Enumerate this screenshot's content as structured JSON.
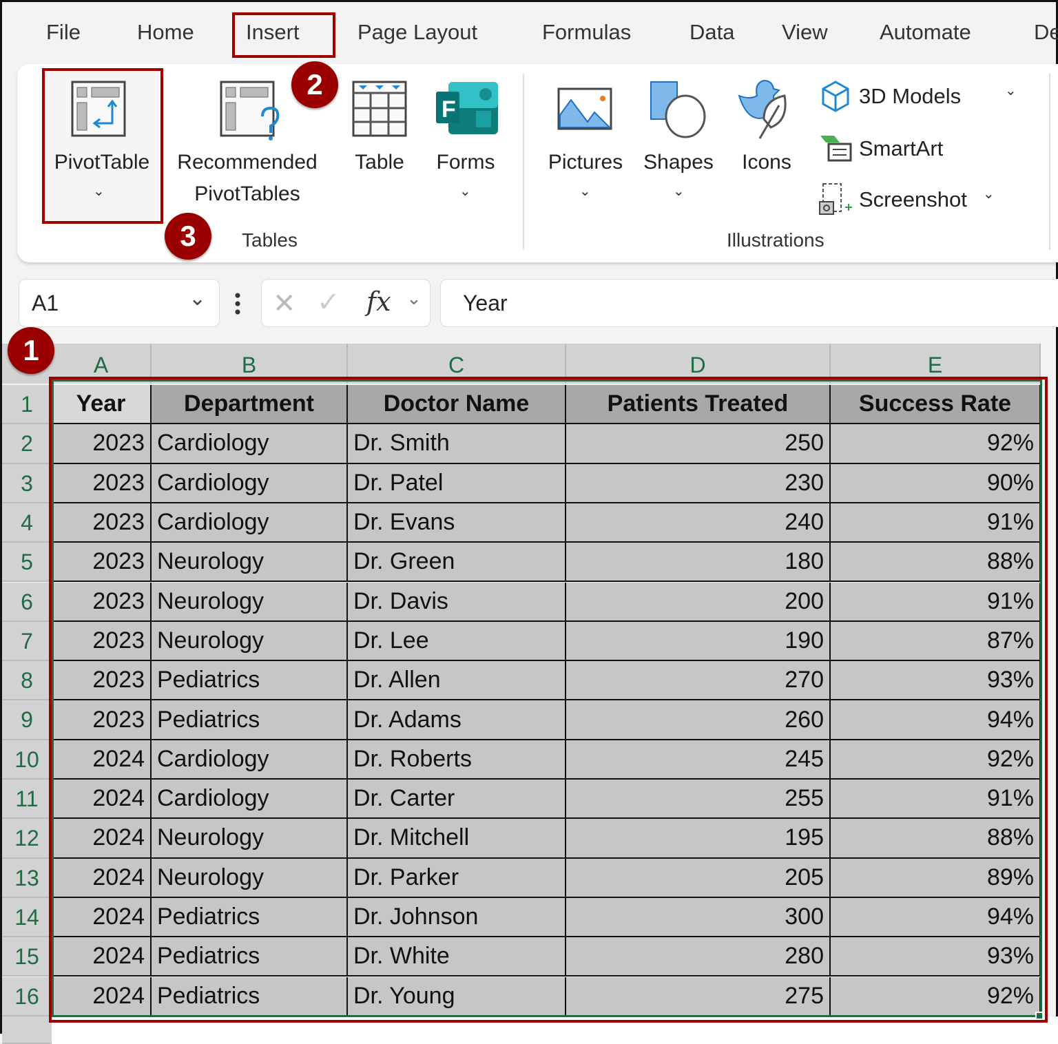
{
  "ribbon_tabs": [
    {
      "label": "File"
    },
    {
      "label": "Home"
    },
    {
      "label": "Insert",
      "active": true
    },
    {
      "label": "Page Layout"
    },
    {
      "label": "Formulas"
    },
    {
      "label": "Data"
    },
    {
      "label": "View"
    },
    {
      "label": "Automate"
    },
    {
      "label": "De"
    }
  ],
  "tables_group": {
    "label": "Tables",
    "pivot_table": "PivotTable",
    "recommended_line1": "Recommended",
    "recommended_line2": "PivotTables",
    "table": "Table",
    "forms": "Forms"
  },
  "illustrations_group": {
    "label": "Illustrations",
    "pictures": "Pictures",
    "shapes": "Shapes",
    "icons": "Icons",
    "models_3d": "3D Models",
    "smartart": "SmartArt",
    "screenshot": "Screenshot"
  },
  "formula_bar": {
    "name_box": "A1",
    "fx": "fx",
    "value": "Year"
  },
  "badges": [
    "1",
    "2",
    "3"
  ],
  "columns": [
    "A",
    "B",
    "C",
    "D",
    "E"
  ],
  "headers": [
    "Year",
    "Department",
    "Doctor Name",
    "Patients Treated",
    "Success Rate"
  ],
  "rows": [
    [
      "2023",
      "Cardiology",
      "Dr. Smith",
      "250",
      "92%"
    ],
    [
      "2023",
      "Cardiology",
      "Dr. Patel",
      "230",
      "90%"
    ],
    [
      "2023",
      "Cardiology",
      "Dr. Evans",
      "240",
      "91%"
    ],
    [
      "2023",
      "Neurology",
      "Dr. Green",
      "180",
      "88%"
    ],
    [
      "2023",
      "Neurology",
      "Dr. Davis",
      "200",
      "91%"
    ],
    [
      "2023",
      "Neurology",
      "Dr. Lee",
      "190",
      "87%"
    ],
    [
      "2023",
      "Pediatrics",
      "Dr. Allen",
      "270",
      "93%"
    ],
    [
      "2023",
      "Pediatrics",
      "Dr. Adams",
      "260",
      "94%"
    ],
    [
      "2024",
      "Cardiology",
      "Dr. Roberts",
      "245",
      "92%"
    ],
    [
      "2024",
      "Cardiology",
      "Dr. Carter",
      "255",
      "91%"
    ],
    [
      "2024",
      "Neurology",
      "Dr. Mitchell",
      "195",
      "88%"
    ],
    [
      "2024",
      "Neurology",
      "Dr. Parker",
      "205",
      "89%"
    ],
    [
      "2024",
      "Pediatrics",
      "Dr. Johnson",
      "300",
      "94%"
    ],
    [
      "2024",
      "Pediatrics",
      "Dr. White",
      "280",
      "93%"
    ],
    [
      "2024",
      "Pediatrics",
      "Dr. Young",
      "275",
      "92%"
    ]
  ],
  "row_numbers": [
    "1",
    "2",
    "3",
    "4",
    "5",
    "6",
    "7",
    "8",
    "9",
    "10",
    "11",
    "12",
    "13",
    "14",
    "15",
    "16"
  ],
  "colors": {
    "annotation": "#9b0000",
    "selection_border": "#1f6b43",
    "selected_fill": "#c6c6c6"
  }
}
